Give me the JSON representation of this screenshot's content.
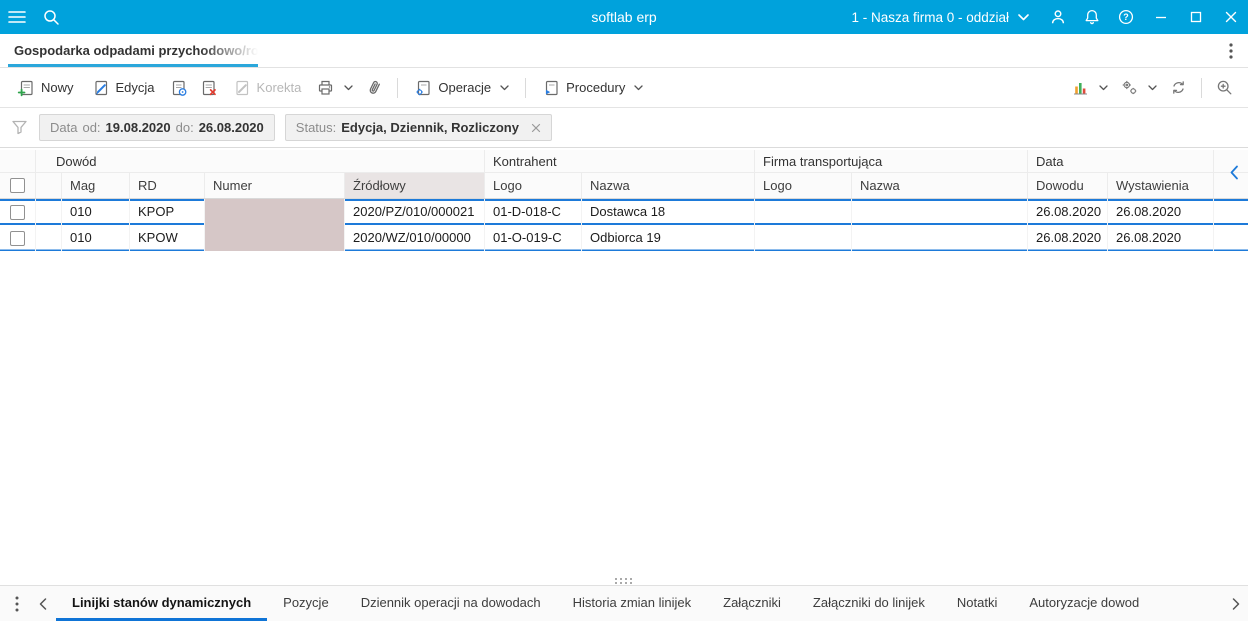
{
  "topbar": {
    "title": "softlab erp",
    "company": "1 - Nasza firma 0 - oddział"
  },
  "doc_tab": {
    "label": "Gospodarka odpadami przychodowo/ro"
  },
  "toolbar": {
    "nowy": "Nowy",
    "edycja": "Edycja",
    "korekta": "Korekta",
    "operacje": "Operacje",
    "procedury": "Procedury"
  },
  "filters": {
    "data_label": "Data",
    "od_label": "od:",
    "od_value": "19.08.2020",
    "do_label": "do:",
    "do_value": "26.08.2020",
    "status_label": "Status:",
    "status_value": "Edycja, Dziennik, Rozliczony"
  },
  "table": {
    "groups": [
      "Dowód",
      "Kontrahent",
      "Firma transportująca",
      "Data"
    ],
    "columns": [
      "Mag",
      "RD",
      "Numer",
      "Źródłowy",
      "Logo",
      "Nazwa",
      "Logo",
      "Nazwa",
      "Dowodu",
      "Wystawienia"
    ],
    "rows": [
      {
        "mag": "010",
        "rd": "KPOP",
        "zrodlowy": "2020/PZ/010/000021",
        "logo_kontrahenta": "01-D-018-C",
        "nazwa_kontrahenta": "Dostawca 18",
        "logo_transport": "",
        "nazwa_transport": "",
        "data_dowodu": "26.08.2020",
        "data_wystawienia": "26.08.2020"
      },
      {
        "mag": "010",
        "rd": "KPOW",
        "zrodlowy": "2020/WZ/010/00000",
        "logo_kontrahenta": "01-O-019-C",
        "nazwa_kontrahenta": "Odbiorca 19",
        "logo_transport": "",
        "nazwa_transport": "",
        "data_dowodu": "26.08.2020",
        "data_wystawienia": "26.08.2020"
      }
    ]
  },
  "bottom_tabs": [
    "Linijki stanów dynamicznych",
    "Pozycje",
    "Dziennik operacji na dowodach",
    "Historia zmian linijek",
    "Załączniki",
    "Załączniki do linijek",
    "Notatki",
    "Autoryzacje dowod"
  ],
  "colors": {
    "topbar": "#00a2dc",
    "accent_tab": "#2ba7db",
    "selection_blue": "#1d7ad9",
    "redacted": "#d6c7c7"
  }
}
